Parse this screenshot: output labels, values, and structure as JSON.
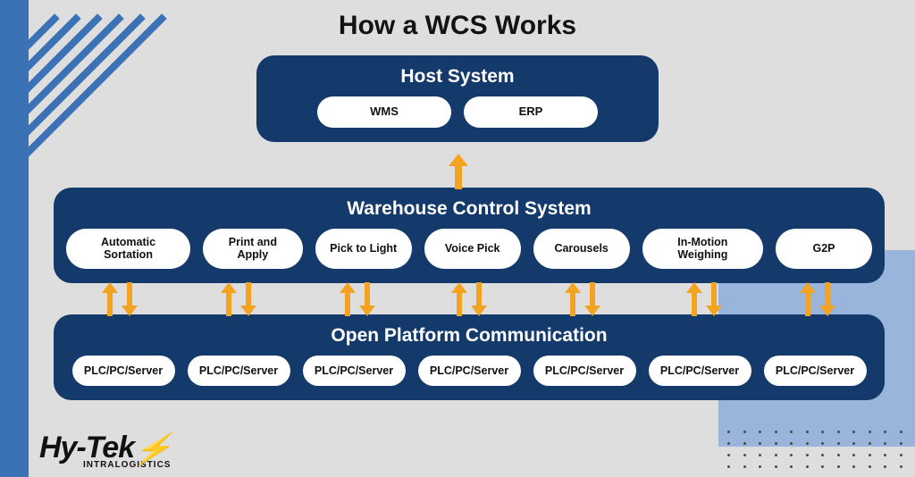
{
  "title": "How a WCS Works",
  "host": {
    "title": "Host System",
    "pills": [
      "WMS",
      "ERP"
    ]
  },
  "wcs": {
    "title": "Warehouse Control System",
    "pills": [
      "Automatic Sortation",
      "Print and Apply",
      "Pick to Light",
      "Voice Pick",
      "Carousels",
      "In-Motion Weighing",
      "G2P"
    ]
  },
  "opc": {
    "title": "Open Platform Communication",
    "pills": [
      "PLC/PC/Server",
      "PLC/PC/Server",
      "PLC/PC/Server",
      "PLC/PC/Server",
      "PLC/PC/Server",
      "PLC/PC/Server",
      "PLC/PC/Server"
    ]
  },
  "logo": {
    "main": "Hy-Tek",
    "sub": "INTRALOGISTICS"
  }
}
